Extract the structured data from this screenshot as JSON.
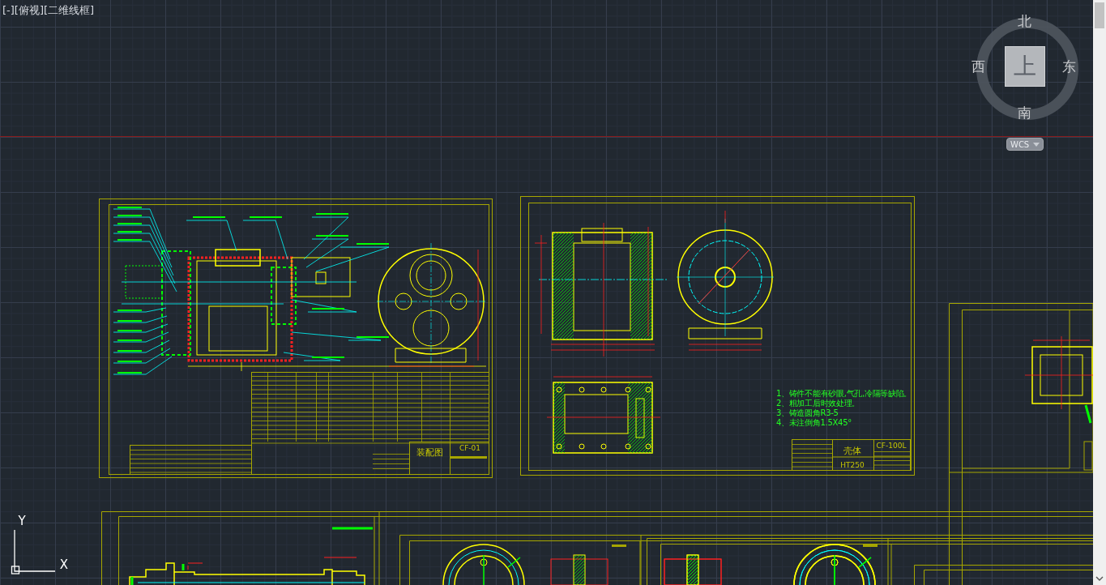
{
  "viewport": {
    "label": "[-][俯视][二维线框]"
  },
  "view_cube": {
    "north": "北",
    "south": "南",
    "east": "东",
    "west": "西",
    "face": "上",
    "ucs_menu": "WCS"
  },
  "ucs_icon": {
    "y_label": "Y",
    "x_label": "X"
  },
  "sheets": [
    {
      "kind": "assembly",
      "title": "装配图",
      "code": "CF-01"
    },
    {
      "kind": "housing",
      "title": "壳体",
      "code": "CF-100L",
      "material": "HT250",
      "notes": [
        "1、铸件不能有砂眼,气孔,冷隔等缺陷。",
        "2、粗加工后时效处理。",
        "3、铸造圆角R3-5",
        "4、未注倒角1.5X45°"
      ]
    },
    {
      "kind": "partial"
    },
    {
      "kind": "shaft"
    },
    {
      "kind": "flange"
    },
    {
      "kind": "flange"
    },
    {
      "kind": "partial"
    }
  ]
}
